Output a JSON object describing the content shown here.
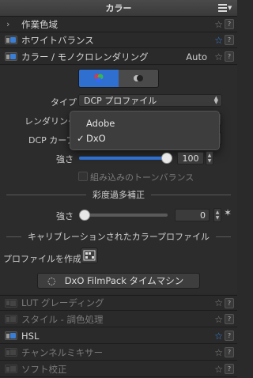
{
  "title": "カラー",
  "rows_top": [
    {
      "label": "作業色域",
      "type": "chevron",
      "star": "gray"
    },
    {
      "label": "ホワイトバランス",
      "type": "toggle-on",
      "star": "blue"
    },
    {
      "label": "カラー / モノクロレンダリング",
      "type": "toggle-on",
      "star": "gray",
      "extra": "Auto"
    }
  ],
  "render": {
    "type_label": "タイプ",
    "type_value": "DCP プロファイル",
    "rendering_label": "レンダリング",
    "dcp_label": "DCP カーブ",
    "popup_options": [
      "Adobe",
      "DxO"
    ],
    "popup_selected": "DxO",
    "check_mark": "✓",
    "intensity_label": "強さ",
    "intensity_value": "100",
    "intensity_fraction": 1.0,
    "builtin_tone_label": "組み込みのトーンバランス"
  },
  "saturation": {
    "header": "彩度過多補正",
    "intensity_label": "強さ",
    "value": "0",
    "fraction": 0.0
  },
  "calibration": {
    "header": "キャリブレーションされたカラープロファイル",
    "create_label": "プロファイルを作成"
  },
  "filmpack_button": "DxO FilmPack タイムマシン",
  "rows_bottom": [
    {
      "label": "LUT グレーディング",
      "type": "toggle-off",
      "star": "gray"
    },
    {
      "label": "スタイル - 調色処理",
      "type": "toggle-off",
      "star": "gray"
    },
    {
      "label": "HSL",
      "type": "toggle-on",
      "star": "blue"
    },
    {
      "label": "チャンネルミキサー",
      "type": "toggle-off",
      "star": "gray"
    },
    {
      "label": "ソフト校正",
      "type": "toggle-off",
      "star": "gray"
    }
  ],
  "help_glyph": "?",
  "colors": {
    "accent": "#2f6fd0",
    "star_blue": "#3a85e0"
  }
}
